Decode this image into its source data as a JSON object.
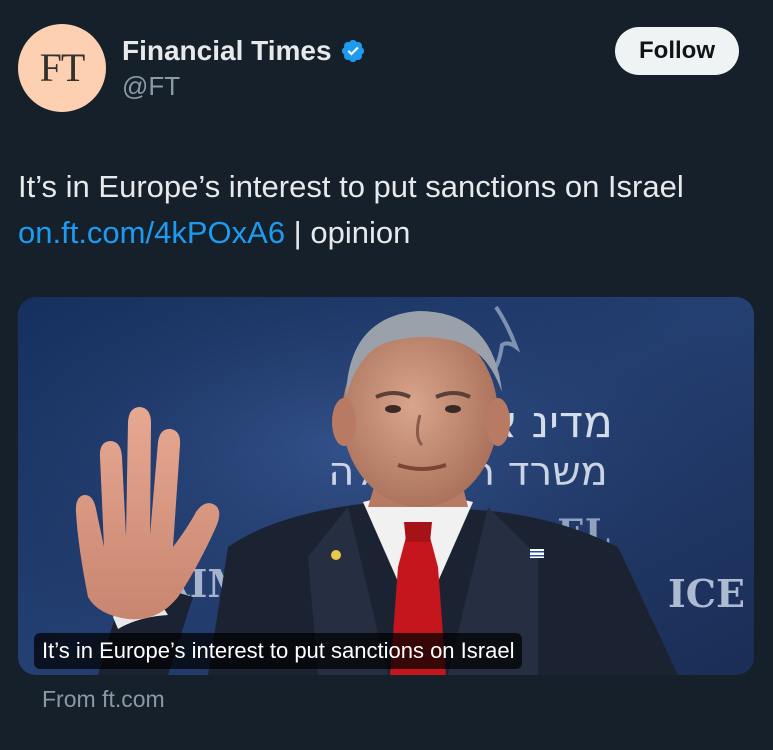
{
  "account": {
    "avatar_text": "FT",
    "display_name": "Financial Times",
    "handle": "@FT",
    "verified": true
  },
  "actions": {
    "follow_label": "Follow"
  },
  "tweet": {
    "text_line1": "It’s in Europe’s interest to put sanctions on Israel",
    "link": "on.ft.com/4kPOxA6",
    "link_suffix": " | opinion"
  },
  "media": {
    "caption": "It’s in Europe’s interest to put sanctions on Israel",
    "backdrop_text_line1": "מדינ   אל",
    "backdrop_text_line2": "משרד ר  ממשלה",
    "backdrop_text_line3": "STA      EL",
    "backdrop_text_left": "RIM",
    "backdrop_text_right": "ICE"
  },
  "card": {
    "source": "From ft.com"
  },
  "colors": {
    "background": "#15202b",
    "link": "#1d9bf0",
    "verified": "#1d9bf0",
    "avatar": "#fcd0b1"
  }
}
